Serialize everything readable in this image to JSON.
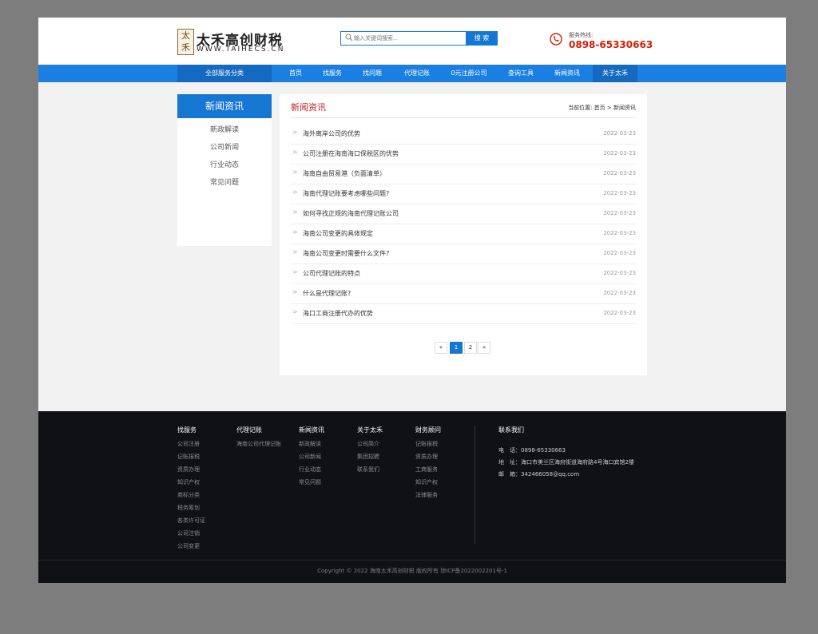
{
  "header": {
    "logo_glyph": "太禾",
    "logo_title": "太禾高创财税",
    "logo_sub": "WWW.TAIHECS.CN",
    "search_placeholder": "输入关键词搜索...",
    "search_button": "搜 索",
    "hotline_label": "服务热线:",
    "hotline_number": "0898-65330663"
  },
  "nav": {
    "all_categories": "全部服务分类",
    "items": [
      "首页",
      "找服务",
      "找问题",
      "代理记账",
      "0元注册公司",
      "查询工具",
      "新闻资讯",
      "关于太禾"
    ]
  },
  "sidebar": {
    "title": "新闻资讯",
    "items": [
      "新政解读",
      "公司新闻",
      "行业动态",
      "常见问题"
    ]
  },
  "main": {
    "title": "新闻资讯",
    "breadcrumb": "当前位置: 首页 > 新闻资讯",
    "articles": [
      {
        "title": "海外离岸公司的优势",
        "date": "2022-03-23"
      },
      {
        "title": "公司注册在海南海口保税区的优势",
        "date": "2022-03-23"
      },
      {
        "title": "海南自由贸易港（负面清单）",
        "date": "2022-03-23"
      },
      {
        "title": "海南代理记账要考虑哪些问题?",
        "date": "2022-03-23"
      },
      {
        "title": "如何寻找正规的海南代理记账公司",
        "date": "2022-03-23"
      },
      {
        "title": "海南公司变更的具体规定",
        "date": "2022-03-23"
      },
      {
        "title": "海南公司变更时需要什么文件?",
        "date": "2022-03-23"
      },
      {
        "title": "公司代理记账的特点",
        "date": "2022-03-23"
      },
      {
        "title": "什么是代理记账?",
        "date": "2022-03-23"
      },
      {
        "title": "海口工商注册代办的优势",
        "date": "2022-03-23"
      }
    ],
    "pagination": {
      "prev": "«",
      "pages": [
        "1",
        "2"
      ],
      "current": "1",
      "next": "»"
    }
  },
  "footer": {
    "columns": [
      {
        "heading": "找服务",
        "links": [
          "公司注册",
          "记账报税",
          "资质办理",
          "知识产权",
          "商标分类",
          "税务筹划",
          "各类许可证",
          "公司注销",
          "公司变更"
        ]
      },
      {
        "heading": "代理记账",
        "links": [
          "海南公司代理记账"
        ]
      },
      {
        "heading": "新闻资讯",
        "links": [
          "新政解读",
          "公司新闻",
          "行业动态",
          "常见问题"
        ]
      },
      {
        "heading": "关于太禾",
        "links": [
          "公司简介",
          "集团招聘",
          "联系我们"
        ]
      },
      {
        "heading": "财务顾问",
        "links": [
          "记账报税",
          "资质办理",
          "工商服务",
          "知识产权",
          "法律服务"
        ]
      }
    ],
    "contact": {
      "heading": "联系我们",
      "phone": "电　话：0898-65330663",
      "address": "地　址：海口市美兰区海府街道海府路4号海口宾馆2楼",
      "email": "邮　箱：342466058@qq.com"
    },
    "copyright": "Copyright © 2022 海南太禾高创财税 版权所有 琼ICP备2022002201号-1"
  },
  "colors": {
    "accent": "#1677d2",
    "nav_bg": "#1a7fe0",
    "hotline": "#d81e06",
    "title_red": "#c81e23",
    "footer_bg": "#101114"
  }
}
